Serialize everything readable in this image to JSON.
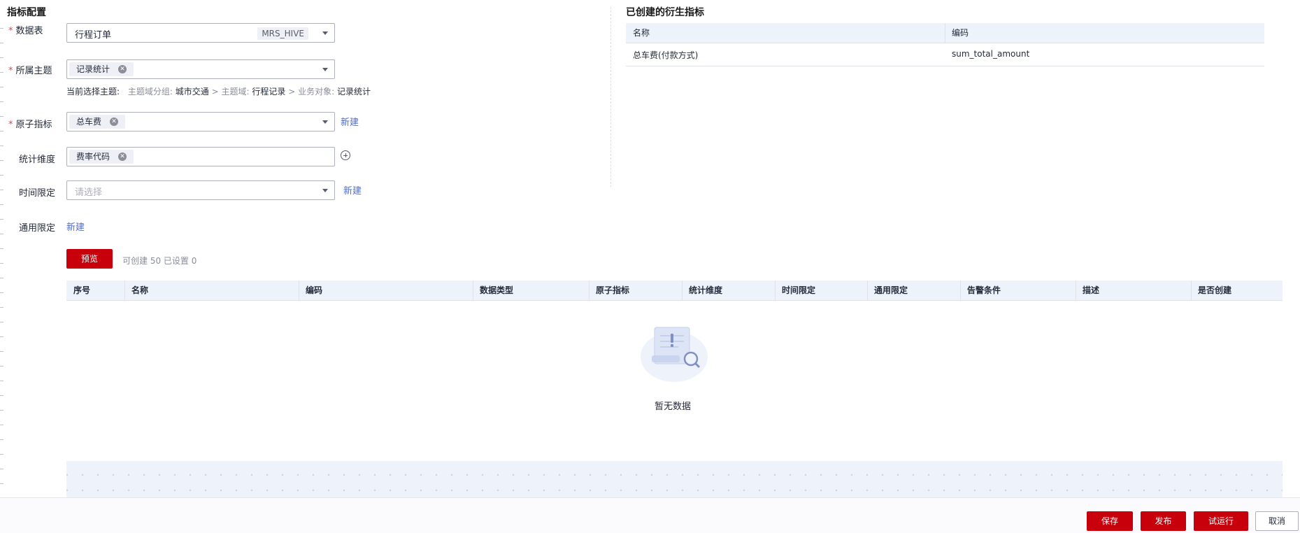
{
  "config": {
    "title": "指标配置",
    "fields": {
      "datatable": {
        "label": "数据表",
        "value": "行程订单",
        "badge": "MRS_HIVE"
      },
      "subject": {
        "label": "所属主题",
        "tag": "记录统计"
      },
      "current_subject": {
        "prefix": "当前选择主题:",
        "group_label": "主题域分组:",
        "group_value": "城市交通",
        "sep1": ">",
        "domain_label": "主题域:",
        "domain_value": "行程记录",
        "sep2": ">",
        "object_label": "业务对象:",
        "object_value": "记录统计"
      },
      "atomic": {
        "label": "原子指标",
        "tag": "总车费",
        "link": "新建"
      },
      "dimension": {
        "label": "统计维度",
        "tag": "费率代码"
      },
      "time_limit": {
        "label": "时间限定",
        "placeholder": "请选择",
        "link": "新建"
      },
      "general_limit": {
        "label": "通用限定",
        "link": "新建"
      }
    },
    "required_mark": "*"
  },
  "created": {
    "title": "已创建的衍生指标",
    "columns": [
      "名称",
      "编码"
    ],
    "rows": [
      {
        "name": "总车费(付款方式)",
        "code": "sum_total_amount"
      }
    ]
  },
  "preview": {
    "button": "预览",
    "info": "可创建 50 已设置 0"
  },
  "result_table": {
    "columns": [
      "序号",
      "名称",
      "编码",
      "数据类型",
      "原子指标",
      "统计维度",
      "时间限定",
      "通用限定",
      "告警条件",
      "描述",
      "是否创建"
    ],
    "empty_text": "暂无数据"
  },
  "footer": {
    "save": "保存",
    "publish": "发布",
    "trial_run": "试运行",
    "cancel": "取消"
  },
  "colors": {
    "primary": "#c7000b",
    "link": "#526ecc",
    "header_bg": "#eef2fb"
  },
  "icons": {
    "add_dimension": "plus-circle-icon",
    "empty": "empty-scroll-search-icon"
  }
}
